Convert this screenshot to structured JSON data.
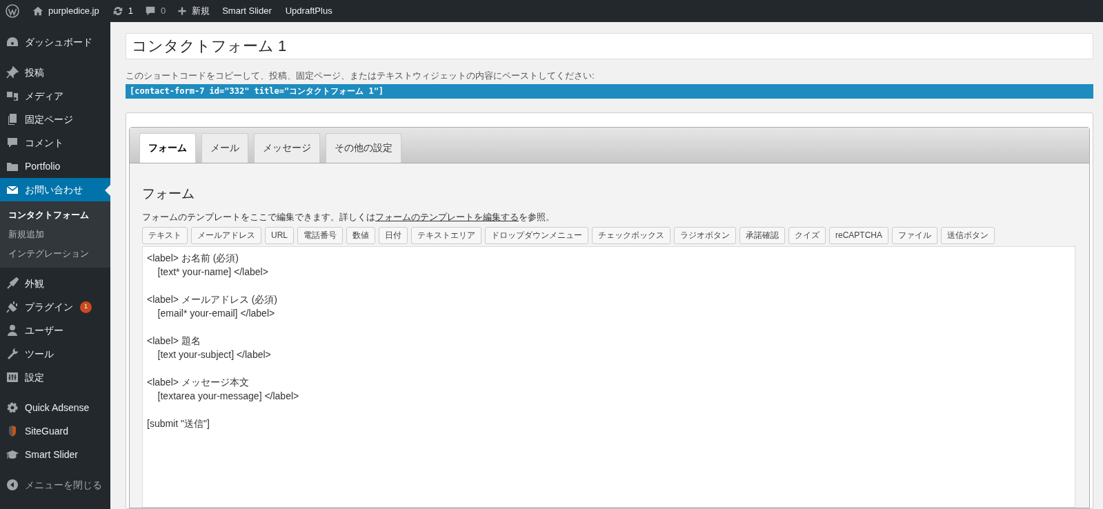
{
  "admin_bar": {
    "site": "purpledice.jp",
    "updates": "1",
    "comments": "0",
    "new": "新規",
    "links": [
      "Smart Slider",
      "UpdraftPlus"
    ]
  },
  "sidebar": {
    "groups": [
      {
        "items": [
          {
            "label": "ダッシュボード",
            "selected": false
          }
        ]
      },
      {
        "items": [
          {
            "label": "投稿",
            "selected": false
          },
          {
            "label": "メディア",
            "selected": false
          },
          {
            "label": "固定ページ",
            "selected": false
          },
          {
            "label": "コメント",
            "selected": false
          },
          {
            "label": "Portfolio",
            "selected": false
          },
          {
            "label": "お問い合わせ",
            "selected": true,
            "children": [
              {
                "label": "コンタクトフォーム",
                "selected": true
              },
              {
                "label": "新規追加",
                "selected": false
              },
              {
                "label": "インテグレーション",
                "selected": false
              }
            ]
          },
          {
            "label": "外観",
            "selected": false
          },
          {
            "label": "プラグイン",
            "selected": false,
            "badge": "1"
          },
          {
            "label": "ユーザー",
            "selected": false
          },
          {
            "label": "ツール",
            "selected": false
          },
          {
            "label": "設定",
            "selected": false
          }
        ]
      },
      {
        "items": [
          {
            "label": "Quick Adsense",
            "selected": false
          },
          {
            "label": "SiteGuard",
            "selected": false
          },
          {
            "label": "Smart Slider",
            "selected": false
          }
        ]
      }
    ],
    "collapse": "メニューを閉じる"
  },
  "title": {
    "value": "コンタクトフォーム 1"
  },
  "shortcode": {
    "hint": "このショートコードをコピーして、投稿、固定ページ、またはテキストウィジェットの内容にペーストしてください:",
    "code": "[contact-form-7 id=\"332\" title=\"コンタクトフォーム 1\"]"
  },
  "tabs": [
    {
      "label": "フォーム",
      "selected": true
    },
    {
      "label": "メール",
      "selected": false
    },
    {
      "label": "メッセージ",
      "selected": false
    },
    {
      "label": "その他の設定",
      "selected": false
    }
  ],
  "form_panel": {
    "heading": "フォーム",
    "description_before": "フォームのテンプレートをここで編集できます。詳しくは",
    "description_link": "フォームのテンプレートを編集する",
    "description_after": "を参照。",
    "tag_buttons": [
      "テキスト",
      "メールアドレス",
      "URL",
      "電話番号",
      "数値",
      "日付",
      "テキストエリア",
      "ドロップダウンメニュー",
      "チェックボックス",
      "ラジオボタン",
      "承諾確認",
      "クイズ",
      "reCAPTCHA",
      "ファイル",
      "送信ボタン"
    ],
    "template": "<label> お名前 (必須)\n    [text* your-name] </label>\n\n<label> メールアドレス (必須)\n    [email* your-email] </label>\n\n<label> 題名\n    [text your-subject] </label>\n\n<label> メッセージ本文\n    [textarea your-message] </label>\n\n[submit \"送信\"]"
  }
}
